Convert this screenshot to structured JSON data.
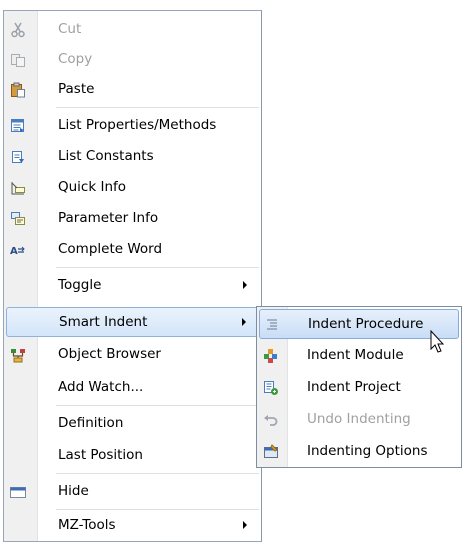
{
  "menu": {
    "items": [
      {
        "label": "Cut",
        "icon": "scissors-icon",
        "enabled": false
      },
      {
        "label": "Copy",
        "icon": "copy-icon",
        "enabled": false
      },
      {
        "label": "Paste",
        "icon": "paste-icon",
        "enabled": true
      },
      {
        "label": "List Properties/Methods",
        "icon": "list-properties-icon",
        "enabled": true
      },
      {
        "label": "List Constants",
        "icon": "list-constants-icon",
        "enabled": true
      },
      {
        "label": "Quick Info",
        "icon": "quick-info-icon",
        "enabled": true
      },
      {
        "label": "Parameter Info",
        "icon": "parameter-info-icon",
        "enabled": true
      },
      {
        "label": "Complete Word",
        "icon": "complete-word-icon",
        "enabled": true
      },
      {
        "label": "Toggle",
        "submenu": true,
        "enabled": true
      },
      {
        "label": "Smart Indent",
        "submenu": true,
        "enabled": true,
        "highlighted": true
      },
      {
        "label": "Object Browser",
        "icon": "object-browser-icon",
        "enabled": true
      },
      {
        "label": "Add Watch...",
        "enabled": true
      },
      {
        "label": "Definition",
        "enabled": true
      },
      {
        "label": "Last Position",
        "enabled": true
      },
      {
        "label": "Hide",
        "icon": "hide-window-icon",
        "enabled": true
      },
      {
        "label": "MZ-Tools",
        "submenu": true,
        "enabled": true
      }
    ]
  },
  "submenu": {
    "items": [
      {
        "label": "Indent Procedure",
        "icon": "indent-procedure-icon",
        "enabled": true,
        "highlighted": true
      },
      {
        "label": "Indent Module",
        "icon": "indent-module-icon",
        "enabled": true
      },
      {
        "label": "Indent Project",
        "icon": "indent-project-icon",
        "enabled": true
      },
      {
        "label": "Undo Indenting",
        "icon": "undo-icon",
        "enabled": false
      },
      {
        "label": "Indenting Options",
        "icon": "indenting-options-icon",
        "enabled": true
      }
    ]
  },
  "colors": {
    "highlight_border": "#8fb2dc",
    "gutter": "#f0f0f0",
    "disabled_text": "#a0a0a0"
  }
}
